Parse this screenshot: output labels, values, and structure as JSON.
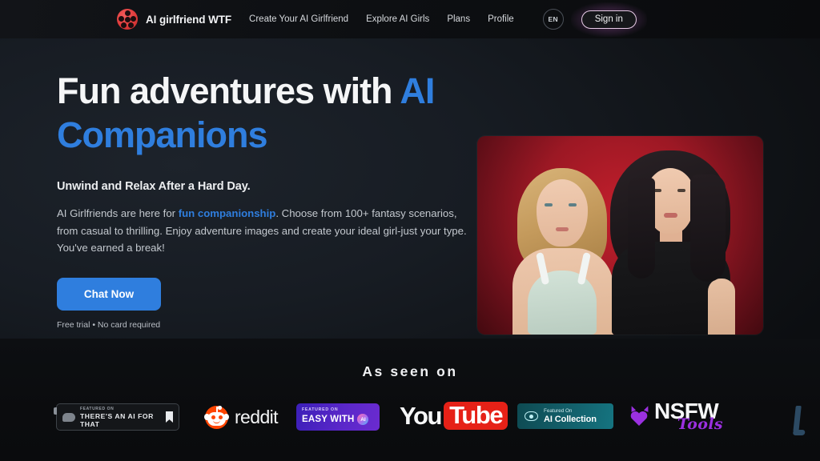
{
  "header": {
    "logo_icon": "film-reel-logo-icon",
    "brand": "AI girlfriend WTF",
    "nav": [
      {
        "label": "Create Your AI Girlfriend"
      },
      {
        "label": "Explore AI Girls"
      },
      {
        "label": "Plans"
      },
      {
        "label": "Profile"
      }
    ],
    "language": "EN",
    "signin_label": "Sign in"
  },
  "hero": {
    "headline_part1": "Fun adventures with ",
    "headline_accent": "AI Companions",
    "subhead": "Unwind and Relax After a Hard Day.",
    "body_part1": "AI Girlfriends are here for ",
    "body_link": "fun companionship",
    "body_part2": ". Choose from 100+ fantasy scenarios, from casual to thrilling. Enjoy adventure images and create your ideal girl-just your type. You've earned a break!",
    "cta_label": "Chat Now",
    "cta_note": "Free trial • No card required",
    "image_alt": "two-ai-girlfriend-companions-on-red-background"
  },
  "as_seen_on": {
    "title": "As seen on",
    "logos": {
      "taaft": {
        "eyebrow": "FEATURED ON",
        "name": "THERE'S AN AI FOR THAT",
        "icon": "bookmark-icon"
      },
      "reddit": {
        "name": "reddit",
        "icon": "reddit-alien-icon"
      },
      "easy_with_ai": {
        "eyebrow": "FEATURED ON",
        "name": "EASY WITH",
        "badge": "AI"
      },
      "youtube": {
        "part1": "You",
        "part2": "Tube"
      },
      "ai_collection": {
        "eyebrow": "Featured On",
        "name": "AI Collection",
        "icon": "eye-icon"
      },
      "nsfw_tools": {
        "name": "NSFW",
        "script": "Tools",
        "icon": "devil-heart-icon"
      }
    }
  },
  "colors": {
    "accent_blue": "#2f7ede",
    "page_bg": "#0a0b0d",
    "hero_bg": "#1d232b",
    "brand_red": "#e03b3b",
    "reddit_orange": "#ff4500",
    "youtube_red": "#e62117",
    "easy_purple": "#5a27c9",
    "aicollection_teal": "#13606b",
    "nsfw_purple": "#9b30e0"
  }
}
